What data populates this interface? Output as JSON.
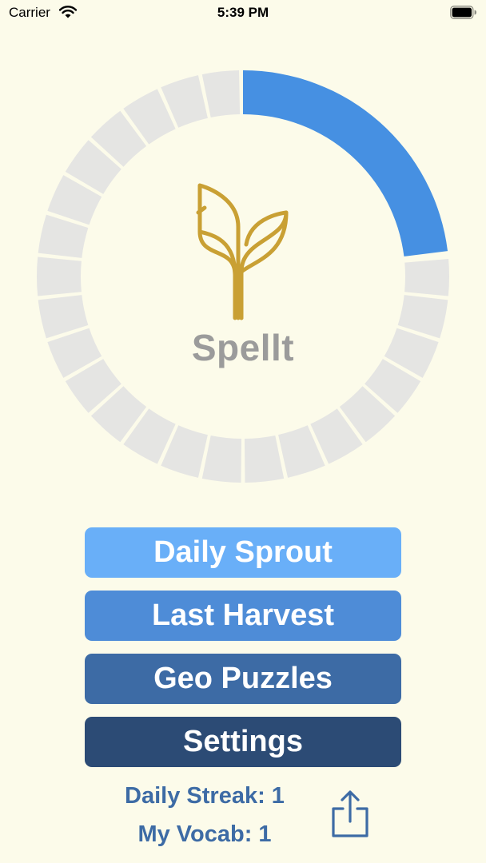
{
  "status_bar": {
    "carrier": "Carrier",
    "time": "5:39 PM"
  },
  "progress": {
    "segments_total": 30,
    "segments_filled": 7,
    "fraction": 0.23
  },
  "app": {
    "name": "Spellt"
  },
  "menu": {
    "daily_sprout": "Daily Sprout",
    "last_harvest": "Last Harvest",
    "geo_puzzles": "Geo Puzzles",
    "settings": "Settings"
  },
  "stats": {
    "daily_streak": "Daily Streak: 1",
    "my_vocab": "My Vocab: 1"
  },
  "icons": {
    "wifi": "wifi-icon",
    "battery": "battery-icon",
    "logo": "wheat-sprout-logo",
    "share": "share-icon"
  },
  "colors": {
    "background": "#FCFBEA",
    "progress_filled": "#4690E2",
    "progress_empty": "#E5E5E3",
    "logo_gold": "#C9A034",
    "app_name": "#9B9B9B",
    "daily_sprout": "#69AFF8",
    "last_harvest": "#4E8CD7",
    "geo_puzzles": "#3D6BA5",
    "settings": "#2C4B75",
    "stats_text": "#3D6BA5"
  }
}
